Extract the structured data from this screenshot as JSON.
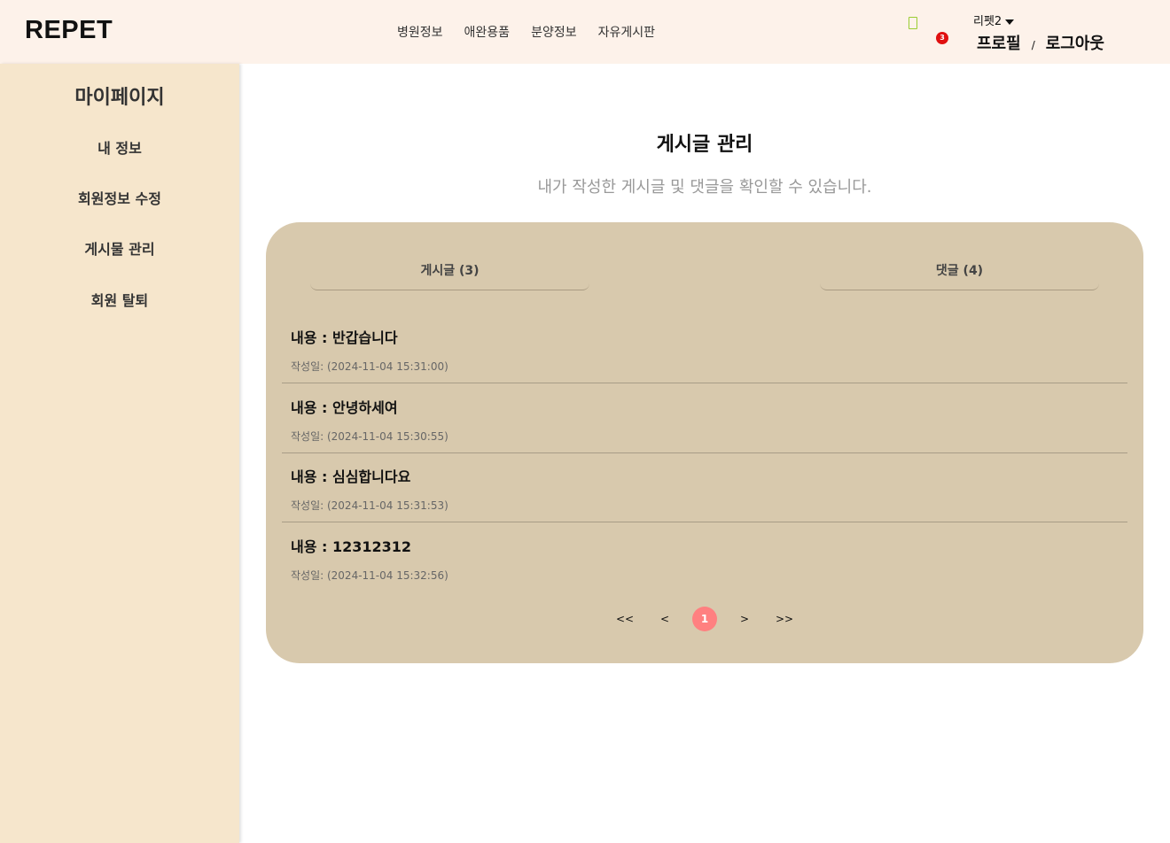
{
  "header": {
    "logo": "REPET",
    "nav": [
      "병원정보",
      "애완용품",
      "분양정보",
      "자유게시판"
    ],
    "notification_count": "3",
    "username": "리펫2",
    "profile_link": "프로필",
    "separator": "/",
    "logout_link": "로그아웃"
  },
  "sidebar": {
    "title": "마이페이지",
    "items": [
      "내 정보",
      "회원정보 수정",
      "게시물 관리",
      "회원 탈퇴"
    ]
  },
  "main": {
    "title": "게시글 관리",
    "subtitle": "내가 작성한 게시글 및 댓글을 확인할 수 있습니다.",
    "tabs": {
      "posts": "게시글 (3)",
      "comments": "댓글 (4)"
    },
    "posts": [
      {
        "content": "내용 : 반갑습니다",
        "date": "작성일: (2024-11-04 15:31:00)"
      },
      {
        "content": "내용 : 안녕하세여",
        "date": "작성일: (2024-11-04 15:30:55)"
      },
      {
        "content": "내용 : 심심합니다요",
        "date": "작성일: (2024-11-04 15:31:53)"
      },
      {
        "content": "내용 : 12312312",
        "date": "작성일: (2024-11-04 15:32:56)"
      }
    ],
    "pagination": {
      "first": "<<",
      "prev": "<",
      "current": "1",
      "next": ">",
      "last": ">>"
    }
  },
  "colors": {
    "header_bg": "#fdf2ea",
    "sidebar_bg": "#f6e6cc",
    "panel_bg": "#d8c9ad",
    "active_page": "#ff8080",
    "badge": "#e01010"
  }
}
